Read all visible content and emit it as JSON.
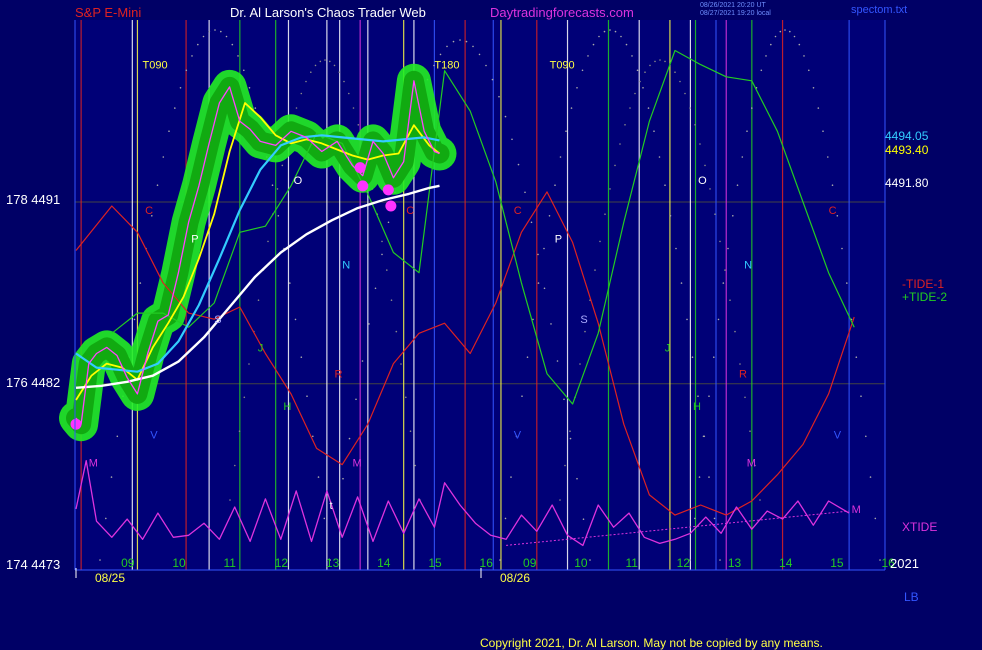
{
  "header": {
    "left_title": "S&P E-Mini",
    "center_title": "Dr. Al Larson's Chaos Trader Web",
    "site": "Daytradingforecasts.com",
    "stamp_line1": "08/26/2021 20:20 UT",
    "stamp_line2": "08/27/2021 19:20 local",
    "file": "spectom.txt"
  },
  "colors": {
    "background": "#000066",
    "plot_bg": "#000077",
    "price": "#ff44ff",
    "fast_avg": "#ffff00",
    "mid_avg": "#33ccff",
    "slow_avg": "#ffffff",
    "glow": "#22ee22",
    "tide1": "#dd2222",
    "tide2": "#22cc22",
    "xtide": "#dd33dd",
    "grid": "#444444"
  },
  "chart_data": {
    "type": "line",
    "title": "S&P E-Mini",
    "x_day_labels": [
      "08/25",
      "08/26"
    ],
    "x_hour_labels": [
      "09",
      "10",
      "11",
      "12",
      "13",
      "14",
      "15",
      "16",
      "09",
      "10",
      "11",
      "12",
      "13",
      "14",
      "15",
      "16"
    ],
    "y_left_labels": [
      "178  4491",
      "176  4482",
      "174  4473"
    ],
    "ylim": [
      4473,
      4500
    ],
    "time_range": [
      8.9,
      40
    ],
    "price_readouts": [
      {
        "text": "4494.05",
        "color": "#33ccff"
      },
      {
        "text": "4493.40",
        "color": "#ffff00"
      },
      {
        "text": "4491.80",
        "color": "#ffffff"
      }
    ],
    "series": [
      {
        "name": "price",
        "x": [
          8.9,
          9.0,
          9.15,
          9.3,
          9.5,
          9.7,
          9.9,
          10.1,
          10.3,
          10.5,
          10.7,
          10.9,
          11.1,
          11.3,
          11.5,
          11.7,
          11.9,
          12.1,
          12.3,
          12.5,
          12.8,
          13.1,
          13.4,
          13.7,
          14.0,
          14.3,
          14.5,
          14.7,
          14.9,
          15.1,
          15.3,
          15.5,
          15.7,
          15.9,
          16.0
        ],
        "values": [
          4480.3,
          4480.0,
          4483.0,
          4483.5,
          4483.8,
          4483.4,
          4482.3,
          4481.5,
          4483.5,
          4485.1,
          4485.4,
          4487.5,
          4490.0,
          4491.8,
          4493.9,
          4495.9,
          4496.7,
          4495.0,
          4494.6,
          4494.0,
          4493.8,
          4494.5,
          4494.2,
          4493.5,
          4494.0,
          4492.8,
          4492.3,
          4494.0,
          4493.4,
          4492.2,
          4493.0,
          4497.0,
          4494.5,
          4493.5,
          4493.4
        ]
      },
      {
        "name": "fast average",
        "x": [
          8.9,
          9.2,
          9.5,
          9.8,
          10.1,
          10.4,
          10.7,
          11.0,
          11.3,
          11.6,
          11.9,
          12.2,
          12.5,
          12.8,
          13.1,
          13.4,
          13.7,
          14.0,
          14.3,
          14.6,
          14.9,
          15.2,
          15.5,
          15.8,
          16.0
        ],
        "values": [
          4481.2,
          4482.4,
          4483.0,
          4482.8,
          4482.2,
          4483.8,
          4485.0,
          4486.3,
          4488.2,
          4490.4,
          4493.5,
          4495.9,
          4495.2,
          4494.3,
          4493.9,
          4494.1,
          4493.9,
          4493.6,
          4493.3,
          4493.1,
          4493.3,
          4493.4,
          4494.8,
          4493.8,
          4493.4
        ]
      },
      {
        "name": "mid average",
        "x": [
          8.9,
          9.3,
          9.7,
          10.1,
          10.5,
          10.9,
          11.3,
          11.7,
          12.1,
          12.5,
          12.9,
          13.3,
          13.7,
          14.1,
          14.5,
          14.9,
          15.3,
          15.7,
          16.0
        ],
        "values": [
          4483.5,
          4482.8,
          4482.7,
          4482.6,
          4483.0,
          4484.1,
          4485.9,
          4488.2,
          4490.6,
          4492.6,
          4493.8,
          4494.2,
          4494.3,
          4494.2,
          4494.1,
          4494.0,
          4494.1,
          4494.2,
          4494.05
        ]
      },
      {
        "name": "slow average",
        "x": [
          8.9,
          9.4,
          9.9,
          10.4,
          10.9,
          11.4,
          11.9,
          12.4,
          12.9,
          13.4,
          13.9,
          14.4,
          14.9,
          15.4,
          15.8,
          16.0
        ],
        "values": [
          4481.8,
          4481.9,
          4482.1,
          4482.4,
          4483.1,
          4484.3,
          4485.8,
          4487.3,
          4488.5,
          4489.4,
          4490.1,
          4490.7,
          4491.1,
          4491.4,
          4491.7,
          4491.8
        ]
      },
      {
        "name": "-TIDE-1",
        "x": [
          8.9,
          9.6,
          10.1,
          10.6,
          11.1,
          11.6,
          12.1,
          12.6,
          13.1,
          13.6,
          14.1,
          14.6,
          15.1,
          15.6,
          16.1,
          16.6,
          17.1,
          17.6,
          18.1,
          18.6,
          19.1,
          19.6,
          20.1,
          20.6,
          21.1,
          21.6,
          22.1,
          22.6,
          23.1,
          23.6,
          24.1
        ],
        "values": [
          4488.6,
          4490.8,
          4489.5,
          4487.0,
          4485.5,
          4485.2,
          4485.8,
          4483.5,
          4481.5,
          4478.8,
          4478.0,
          4480.0,
          4483.0,
          4484.5,
          4485.0,
          4483.5,
          4486.0,
          4489.5,
          4491.5,
          4489.0,
          4485.0,
          4480.0,
          4476.5,
          4475.5,
          4476.0,
          4475.5,
          4476.2,
          4477.5,
          4479.0,
          4481.5,
          4485.3
        ]
      },
      {
        "name": "+TIDE-2",
        "x": [
          9.6,
          10.1,
          10.6,
          11.1,
          11.6,
          12.1,
          12.6,
          13.1,
          13.6,
          14.1,
          14.6,
          15.1,
          15.6,
          16.1,
          16.6,
          17.1,
          17.6,
          18.1,
          18.6,
          19.1,
          19.6,
          20.1,
          20.6,
          21.1,
          21.6,
          22.1,
          22.6,
          23.1,
          23.6,
          24.1
        ],
        "values": [
          4484.5,
          4485.5,
          4485.5,
          4484.8,
          4486.0,
          4489.5,
          4489.8,
          4491.8,
          4494.4,
          4493.9,
          4491.4,
          4488.5,
          4487.5,
          4497.5,
          4495.5,
          4492.0,
          4487.0,
          4482.5,
          4481.0,
          4484.5,
          4490.0,
          4495.0,
          4498.5,
          4497.8,
          4497.2,
          4497.0,
          4494.5,
          4491.0,
          4487.5,
          4484.8
        ]
      },
      {
        "name": "XTIDE",
        "x": [
          8.9,
          9.1,
          9.3,
          9.6,
          9.9,
          10.2,
          10.5,
          10.8,
          11.1,
          11.4,
          11.7,
          12.0,
          12.3,
          12.6,
          12.9,
          13.2,
          13.5,
          13.8,
          14.1,
          14.4,
          14.7,
          15.0,
          15.3,
          15.6,
          15.9,
          16.1,
          16.4,
          16.7,
          17.0,
          17.3,
          17.6,
          17.9,
          18.2,
          18.5,
          18.8,
          19.1,
          19.4,
          19.7,
          20.0,
          20.3,
          20.6,
          20.9,
          21.2,
          21.5,
          21.8,
          22.1,
          22.4,
          22.7,
          23.0,
          23.3,
          23.6,
          24.0
        ],
        "values": [
          4475.8,
          4478.2,
          4475.2,
          4474.4,
          4475.3,
          4474.3,
          4475.6,
          4474.4,
          4474.5,
          4475.1,
          4474.3,
          4475.9,
          4474.2,
          4476.3,
          4474.3,
          4476.7,
          4474.2,
          4476.7,
          4474.4,
          4476.4,
          4474.2,
          4476.2,
          4474.6,
          4476.3,
          4474.9,
          4477.1,
          4476.0,
          4475.1,
          4474.5,
          4474.3,
          4475.5,
          4474.7,
          4476.0,
          4474.5,
          4474.0,
          4476.0,
          4474.9,
          4475.6,
          4474.4,
          4474.1,
          4474.3,
          4474.6,
          4475.4,
          4474.6,
          4475.9,
          4474.8,
          4475.7,
          4475.3,
          4476.2,
          4475.0,
          4476.2,
          4475.6
        ]
      }
    ],
    "magenta_dots": [
      {
        "t": 8.9,
        "v": 4480.0
      },
      {
        "t": 14.45,
        "v": 4492.7
      },
      {
        "t": 14.5,
        "v": 4491.8
      },
      {
        "t": 15.0,
        "v": 4491.6
      },
      {
        "t": 15.05,
        "v": 4490.8
      }
    ],
    "vertical_lines": [
      {
        "t": 9.0,
        "color": "#dd2222"
      },
      {
        "t": 10.0,
        "color": "#ffffff"
      },
      {
        "t": 10.1,
        "color": "#ffff44"
      },
      {
        "t": 11.05,
        "color": "#dd2222"
      },
      {
        "t": 11.5,
        "color": "#ffffff"
      },
      {
        "t": 12.1,
        "color": "#22cc22"
      },
      {
        "t": 12.8,
        "color": "#22cc22"
      },
      {
        "t": 13.05,
        "color": "#ffffff"
      },
      {
        "t": 13.8,
        "color": "#ffffff"
      },
      {
        "t": 14.05,
        "color": "#ffffff"
      },
      {
        "t": 14.45,
        "color": "#dd33dd"
      },
      {
        "t": 14.6,
        "color": "#ffffff"
      },
      {
        "t": 15.3,
        "color": "#ffff44"
      },
      {
        "t": 15.5,
        "color": "#ffffff"
      },
      {
        "t": 15.9,
        "color": "#3355ff"
      },
      {
        "t": 16.5,
        "color": "#dd2222"
      },
      {
        "t": 17.05,
        "color": "#3355ff"
      },
      {
        "t": 17.2,
        "color": "#ffff44"
      },
      {
        "t": 17.9,
        "color": "#dd2222"
      },
      {
        "t": 18.5,
        "color": "#ffffff"
      },
      {
        "t": 19.3,
        "color": "#22cc22"
      },
      {
        "t": 19.9,
        "color": "#ffffff"
      },
      {
        "t": 20.5,
        "color": "#ffff44"
      },
      {
        "t": 20.9,
        "color": "#ffffff"
      },
      {
        "t": 21.0,
        "color": "#22cc22"
      },
      {
        "t": 21.4,
        "color": "#3355ff"
      },
      {
        "t": 21.6,
        "color": "#dd33dd"
      },
      {
        "t": 22.1,
        "color": "#22cc22"
      },
      {
        "t": 22.7,
        "color": "#dd2222"
      },
      {
        "t": 24.0,
        "color": "#3355ff"
      }
    ],
    "markers": [
      {
        "t": 10.2,
        "v": 4497.6,
        "text": "T090",
        "color": "#ffff44"
      },
      {
        "t": 15.9,
        "v": 4497.6,
        "text": "T180",
        "color": "#ffff44"
      },
      {
        "t": 18.15,
        "v": 4497.6,
        "text": "T090",
        "color": "#ffff44"
      },
      {
        "t": 10.25,
        "v": 4490.4,
        "text": "C",
        "color": "#dd2222"
      },
      {
        "t": 15.35,
        "v": 4490.4,
        "text": "C",
        "color": "#dd2222"
      },
      {
        "t": 17.45,
        "v": 4490.4,
        "text": "C",
        "color": "#dd2222"
      },
      {
        "t": 23.6,
        "v": 4490.4,
        "text": "C",
        "color": "#dd2222"
      },
      {
        "t": 11.15,
        "v": 4489.0,
        "text": "P",
        "color": "#ffffff"
      },
      {
        "t": 18.25,
        "v": 4489.0,
        "text": "P",
        "color": "#ffffff"
      },
      {
        "t": 13.15,
        "v": 4491.9,
        "text": "O",
        "color": "#ffffff"
      },
      {
        "t": 21.05,
        "v": 4491.9,
        "text": "O",
        "color": "#ffffff"
      },
      {
        "t": 14.1,
        "v": 4487.7,
        "text": "N",
        "color": "#33ccff"
      },
      {
        "t": 21.95,
        "v": 4487.7,
        "text": "N",
        "color": "#33ccff"
      },
      {
        "t": 11.6,
        "v": 4485.0,
        "text": "S",
        "color": "#aaaaff"
      },
      {
        "t": 18.75,
        "v": 4485.0,
        "text": "S",
        "color": "#aaaaff"
      },
      {
        "t": 12.45,
        "v": 4483.6,
        "text": "J",
        "color": "#22cc22"
      },
      {
        "t": 20.4,
        "v": 4483.6,
        "text": "J",
        "color": "#22cc22"
      },
      {
        "t": 13.95,
        "v": 4482.3,
        "text": "R",
        "color": "#dd2222"
      },
      {
        "t": 21.85,
        "v": 4482.3,
        "text": "R",
        "color": "#dd2222"
      },
      {
        "t": 12.95,
        "v": 4480.7,
        "text": "H",
        "color": "#22cc22"
      },
      {
        "t": 20.95,
        "v": 4480.7,
        "text": "H",
        "color": "#22cc22"
      },
      {
        "t": 10.35,
        "v": 4479.3,
        "text": "V",
        "color": "#3355ff"
      },
      {
        "t": 17.45,
        "v": 4479.3,
        "text": "V",
        "color": "#3355ff"
      },
      {
        "t": 23.7,
        "v": 4479.3,
        "text": "V",
        "color": "#3355ff"
      },
      {
        "t": 9.15,
        "v": 4477.9,
        "text": "M",
        "color": "#dd33dd"
      },
      {
        "t": 14.3,
        "v": 4477.9,
        "text": "M",
        "color": "#dd33dd"
      },
      {
        "t": 22.0,
        "v": 4477.9,
        "text": "M",
        "color": "#dd33dd"
      },
      {
        "t": 24.05,
        "v": 4475.6,
        "text": "M",
        "color": "#dd33dd"
      },
      {
        "t": 13.85,
        "v": 4475.8,
        "text": "t",
        "color": "#ffffff"
      }
    ]
  },
  "right_labels": {
    "tide1": "-TIDE-1",
    "tide2": "+TIDE-2",
    "xtide": "XTIDE",
    "year": "2021",
    "lb": "LB"
  },
  "footer": {
    "copyright": "Copyright 2021, Dr. Al Larson. May not be copied by any means."
  }
}
